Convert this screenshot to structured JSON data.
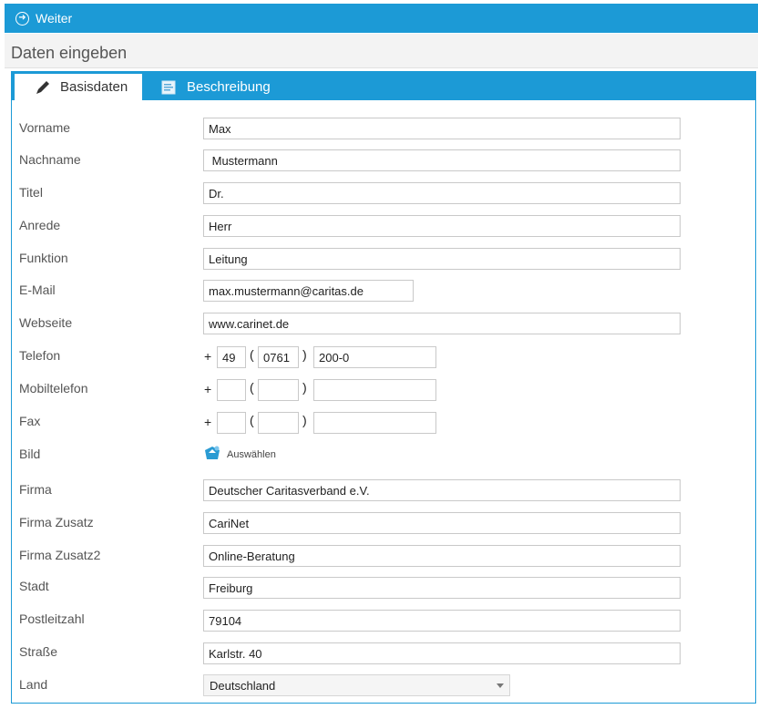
{
  "topbar": {
    "label": "Weiter",
    "icon": "arrow-right-circle-icon"
  },
  "section": {
    "title": "Daten eingeben"
  },
  "tabs": [
    {
      "label": "Basisdaten",
      "icon": "pencil-icon",
      "active": true
    },
    {
      "label": "Beschreibung",
      "icon": "text-document-icon",
      "active": false
    }
  ],
  "form": {
    "vorname": {
      "label": "Vorname",
      "value": "Max"
    },
    "nachname": {
      "label": "Nachname",
      "value": " Mustermann"
    },
    "titel": {
      "label": "Titel",
      "value": "Dr."
    },
    "anrede": {
      "label": "Anrede",
      "value": "Herr"
    },
    "funktion": {
      "label": "Funktion",
      "value": "Leitung"
    },
    "email": {
      "label": "E-Mail",
      "value": "max.mustermann@caritas.de"
    },
    "webseite": {
      "label": "Webseite",
      "value": "www.carinet.de"
    },
    "telefon": {
      "label": "Telefon",
      "country": "49",
      "area": "0761",
      "number": "200-0"
    },
    "mobiltelefon": {
      "label": "Mobiltelefon",
      "country": "",
      "area": "",
      "number": ""
    },
    "fax": {
      "label": "Fax",
      "country": "",
      "area": "",
      "number": ""
    },
    "bild": {
      "label": "Bild",
      "button": "Auswählen"
    },
    "firma": {
      "label": "Firma",
      "value": "Deutscher Caritasverband e.V."
    },
    "firma_zusatz": {
      "label": "Firma Zusatz",
      "value": "CariNet"
    },
    "firma_zusatz2": {
      "label": "Firma Zusatz2",
      "value": "Online-Beratung"
    },
    "stadt": {
      "label": "Stadt",
      "value": "Freiburg"
    },
    "plz": {
      "label": "Postleitzahl",
      "value": "79104"
    },
    "strasse": {
      "label": "Straße",
      "value": "Karlstr. 40"
    },
    "land": {
      "label": "Land",
      "value": "Deutschland"
    }
  },
  "phone_symbols": {
    "plus": "+",
    "open": "(",
    "close": ")"
  },
  "colors": {
    "accent": "#1c9ad6",
    "header_bg": "#f3f3f3"
  }
}
